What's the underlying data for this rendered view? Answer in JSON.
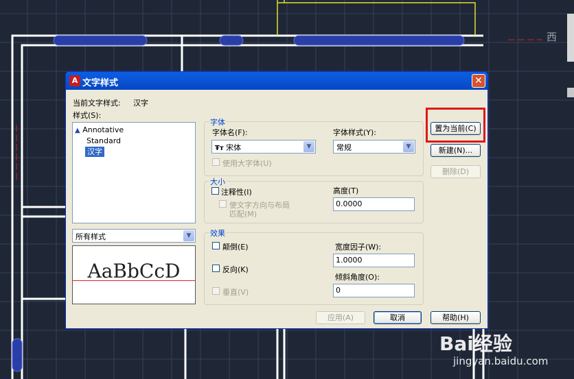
{
  "dialog": {
    "title": "文字样式",
    "current_style_label": "当前文字样式:",
    "current_style_value": "汉字",
    "styles_label": "样式(S):",
    "styles": [
      "Annotative",
      "Standard",
      "汉字"
    ],
    "filter_value": "所有样式",
    "preview_text": "AaBbCcD",
    "font_group": {
      "title": "字体",
      "font_name_label": "字体名(F):",
      "font_name_value": "宋体",
      "font_style_label": "字体样式(Y):",
      "font_style_value": "常规",
      "big_font_label": "使用大字体(U)"
    },
    "size_group": {
      "title": "大小",
      "annotative_label": "注释性(I)",
      "match_layout_label_1": "使文字方向与布局",
      "match_layout_label_2": "匹配(M)",
      "height_label": "高度(T)",
      "height_value": "0.0000"
    },
    "effects_group": {
      "title": "效果",
      "upside_down_label": "颠倒(E)",
      "backwards_label": "反向(K)",
      "vertical_label": "垂直(V)",
      "width_factor_label": "宽度因子(W):",
      "width_factor_value": "1.0000",
      "oblique_label": "倾斜角度(O):",
      "oblique_value": "0"
    },
    "buttons": {
      "set_current": "置为当前(C)",
      "new": "新建(N)...",
      "delete": "删除(D)",
      "apply": "应用(A)",
      "cancel": "取消",
      "help": "帮助(H)"
    }
  },
  "background": {
    "compass_label": "西"
  },
  "watermark": {
    "brand": "Bai经验",
    "url": "jingyan.baidu.com"
  },
  "colors": {
    "cad_background": "#1f2736",
    "highlight": "#e01818",
    "titlebar": "#0b55d4"
  }
}
